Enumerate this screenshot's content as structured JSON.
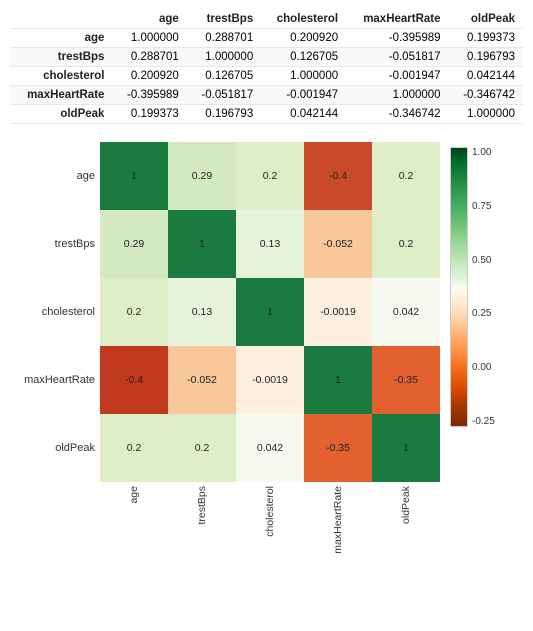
{
  "table": {
    "columns": [
      "",
      "age",
      "trestBps",
      "cholesterol",
      "maxHeartRate",
      "oldPeak"
    ],
    "rows": [
      {
        "label": "age",
        "age": "1.000000",
        "trestBps": "0.288701",
        "cholesterol": "0.200920",
        "maxHeartRate": "-0.395989",
        "oldPeak": "0.199373"
      },
      {
        "label": "trestBps",
        "age": "0.288701",
        "trestBps": "1.000000",
        "cholesterol": "0.126705",
        "maxHeartRate": "-0.051817",
        "oldPeak": "0.196793"
      },
      {
        "label": "cholesterol",
        "age": "0.200920",
        "trestBps": "0.126705",
        "cholesterol": "1.000000",
        "maxHeartRate": "-0.001947",
        "oldPeak": "0.042144"
      },
      {
        "label": "maxHeartRate",
        "age": "-0.395989",
        "trestBps": "-0.051817",
        "cholesterol": "-0.001947",
        "maxHeartRate": "1.000000",
        "oldPeak": "-0.346742"
      },
      {
        "label": "oldPeak",
        "age": "0.199373",
        "trestBps": "0.196793",
        "cholesterol": "0.042144",
        "maxHeartRate": "-0.346742",
        "oldPeak": "1.000000"
      }
    ]
  },
  "heatmap": {
    "row_labels": [
      "age",
      "trestBps",
      "cholesterol",
      "maxHeartRate",
      "oldPeak"
    ],
    "col_labels": [
      "age",
      "trestBps",
      "cholesterol",
      "maxHeartRate",
      "oldPeak"
    ],
    "cells": [
      [
        {
          "value": "1",
          "bg": "#1a7a40"
        },
        {
          "value": "0.29",
          "bg": "#d4e8c2"
        },
        {
          "value": "0.2",
          "bg": "#ddeec9"
        },
        {
          "value": "-0.4",
          "bg": "#c94a2a"
        },
        {
          "value": "0.2",
          "bg": "#ddeec9"
        }
      ],
      [
        {
          "value": "0.29",
          "bg": "#d4e8c2"
        },
        {
          "value": "1",
          "bg": "#1a7a40"
        },
        {
          "value": "0.13",
          "bg": "#e8f3dc"
        },
        {
          "value": "-0.052",
          "bg": "#f8c89a"
        },
        {
          "value": "0.2",
          "bg": "#ddeec9"
        }
      ],
      [
        {
          "value": "0.2",
          "bg": "#ddeec9"
        },
        {
          "value": "0.13",
          "bg": "#e8f3dc"
        },
        {
          "value": "1",
          "bg": "#1a7a40"
        },
        {
          "value": "-0.0019",
          "bg": "#fef0e0"
        },
        {
          "value": "0.042",
          "bg": "#f5f9f0"
        }
      ],
      [
        {
          "value": "-0.4",
          "bg": "#c0391e"
        },
        {
          "value": "-0.052",
          "bg": "#f8c89a"
        },
        {
          "value": "-0.0019",
          "bg": "#fef0e0"
        },
        {
          "value": "1",
          "bg": "#1a7a40"
        },
        {
          "value": "-0.35",
          "bg": "#e36030"
        }
      ],
      [
        {
          "value": "0.2",
          "bg": "#ddeec9"
        },
        {
          "value": "0.2",
          "bg": "#ddeec9"
        },
        {
          "value": "0.042",
          "bg": "#f5f9f0"
        },
        {
          "value": "-0.35",
          "bg": "#e36030"
        },
        {
          "value": "1",
          "bg": "#1a7a40"
        }
      ]
    ],
    "colorbar": {
      "labels": [
        "1.00",
        "0.75",
        "0.50",
        "0.25",
        "0.00",
        "-0.25"
      ]
    }
  }
}
